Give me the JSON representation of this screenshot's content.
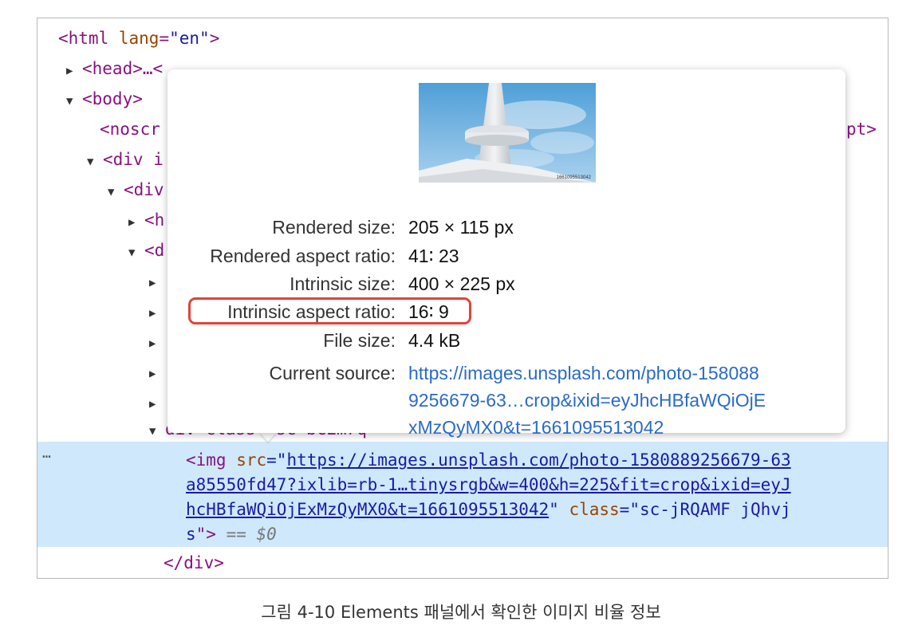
{
  "dom": {
    "html_open": "<html",
    "lang_attr": "lang",
    "lang_val": "\"en\"",
    "close": ">",
    "head": "<head>…<",
    "body": "<body>",
    "noscr": "<noscr",
    "pt": "pt>",
    "div_i": "<div i",
    "div": "<div",
    "h": "<h",
    "d": "<d",
    "dot": ".",
    "div_close": "</div>",
    "partial": "div class= sc-bCEmrq"
  },
  "selected": {
    "open": "<img ",
    "src_attr": "src",
    "eq": "=\"",
    "url1": "https://images.unsplash.com/photo-1580889256679-63",
    "url2": "a85550fd47?ixlib=rb-1…tinysrgb&w=400&h=225&fit=crop&ixid=eyJ",
    "url3": "hcHBfaWQiOjExMzQyMX0&t=1661095513042",
    "q_close": "\" ",
    "class_attr": "class",
    "class_eq": "=\"",
    "class_val1": "sc-jRQAMF jQhvj",
    "class_val2": "s",
    "end": "\">",
    "dollar": " == $0",
    "dots": "…"
  },
  "tooltip": {
    "thumb_label": "1661095513042",
    "rows": [
      {
        "key": "Rendered size:",
        "value": "205 × 115 px"
      },
      {
        "key": "Rendered aspect ratio:",
        "value": "41∶ 23"
      },
      {
        "key": "Intrinsic size:",
        "value": "400 × 225 px"
      },
      {
        "key": "Intrinsic aspect ratio:",
        "value": "16∶ 9"
      },
      {
        "key": "File size:",
        "value": "4.4 kB"
      },
      {
        "key": "Current source:",
        "value": ""
      }
    ],
    "source_lines": [
      "https://images.unsplash.com/photo-158088",
      "9256679-63…crop&ixid=eyJhcHBfaWQiOjE",
      "xMzQyMX0&t=1661095513042"
    ]
  },
  "colors": {
    "highlight": "#e0443a",
    "selection": "#cfe8fc",
    "link": "#2a6bc6"
  },
  "caption": "그림 4-10 Elements 패널에서 확인한 이미지 비율 정보"
}
